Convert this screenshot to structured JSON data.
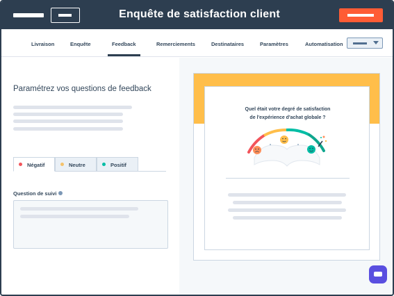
{
  "header": {
    "title": "Enquête de satisfaction client",
    "brand_color": "#2d3e50",
    "cta_color": "#ff5c35"
  },
  "tabs": [
    {
      "label": "Livraison",
      "active": false
    },
    {
      "label": "Enquête",
      "active": false
    },
    {
      "label": "Feedback",
      "active": true
    },
    {
      "label": "Remerciements",
      "active": false
    },
    {
      "label": "Destinataires",
      "active": false
    },
    {
      "label": "Paramètres",
      "active": false
    },
    {
      "label": "Automatisation",
      "active": false
    }
  ],
  "left_panel": {
    "title": "Paramétrez vos questions de feedback",
    "sentiment_tabs": [
      {
        "label": "Négatif",
        "color": "#f2545b",
        "active": true
      },
      {
        "label": "Neutre",
        "color": "#f5c26b",
        "active": false
      },
      {
        "label": "Positif",
        "color": "#00bda5",
        "active": false
      }
    ],
    "follow_up_label": "Question de suivi"
  },
  "preview": {
    "question_line1": "Quel était votre degré de satisfaction",
    "question_line2": "de l'expérience d'achat globale ?",
    "band_color": "#ffbe4a"
  },
  "icons": {
    "sad": "sad-face-icon",
    "neutral": "neutral-face-icon",
    "happy": "happy-face-icon",
    "info": "info-icon",
    "chat": "chat-icon",
    "chevron": "chevron-down-icon"
  }
}
